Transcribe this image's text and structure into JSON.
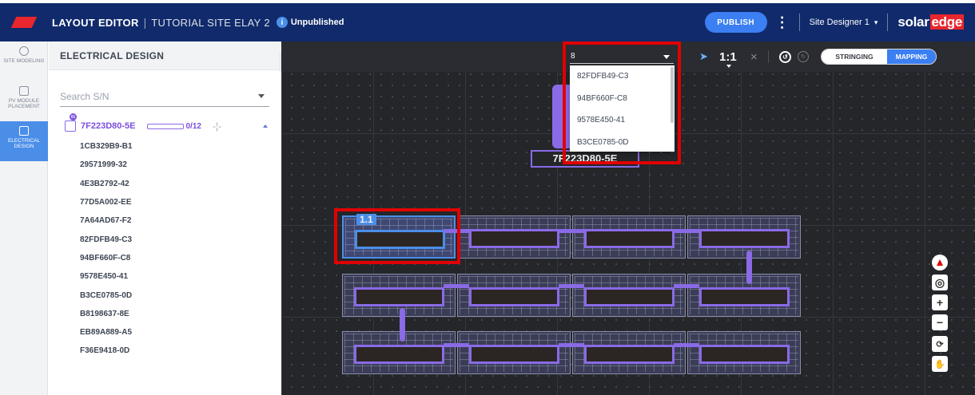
{
  "header": {
    "app_title": "LAYOUT EDITOR",
    "separator": "|",
    "site_name": "TUTORIAL SITE ELAY 2",
    "info_glyph": "i",
    "status": "Unpublished",
    "publish_label": "PUBLISH",
    "user_label": "Site Designer 1",
    "brand_solar": "solar",
    "brand_edge": "edge"
  },
  "rail": {
    "items": [
      {
        "label": "SITE MODELING",
        "icon": "cube-icon"
      },
      {
        "label": "PV MODULE PLACEMENT",
        "icon": "grid-icon"
      },
      {
        "label": "ELECTRICAL DESIGN",
        "icon": "electrical-icon",
        "active": true
      }
    ]
  },
  "panel": {
    "title": "ELECTRICAL DESIGN",
    "search_placeholder": "Search S/N",
    "inverter": {
      "badge": "01",
      "name": "7F223D80-5E",
      "count": "0/12",
      "progress": 0
    },
    "serials": [
      "1CB329B9-B1",
      "29571999-32",
      "4E3B2792-42",
      "77D5A002-EE",
      "7A64AD67-F2",
      "82FDFB49-C3",
      "94BF660F-C8",
      "9578E450-41",
      "B3CE0785-0D",
      "B8198637-8E",
      "EB89A889-A5",
      "F36E9418-0D"
    ]
  },
  "canvas": {
    "sn_input_value": "8",
    "dropdown_options": [
      "82FDFB49-C3",
      "94BF660F-C8",
      "9578E450-41",
      "B3CE0785-0D"
    ],
    "zoom_label": "1:1",
    "close_glyph": "×",
    "undo_glyph": "↺",
    "redo_glyph": "↻",
    "mode_stringing": "STRINGING",
    "mode_mapping": "MAPPING",
    "inverter_label": "7F223D80-5E",
    "selected_module_label": "1.1",
    "map_controls": [
      "compass-icon",
      "locate-icon",
      "zoom-in-icon",
      "zoom-out-icon",
      "rotate-icon",
      "pan-icon"
    ],
    "zoom_in_glyph": "+",
    "zoom_out_glyph": "−"
  },
  "colors": {
    "topbar": "#102a6b",
    "accent_blue": "#3b7ff2",
    "string_purple": "#8a6ae6",
    "highlight_red": "#e00000",
    "canvas_bg": "#24262a"
  }
}
